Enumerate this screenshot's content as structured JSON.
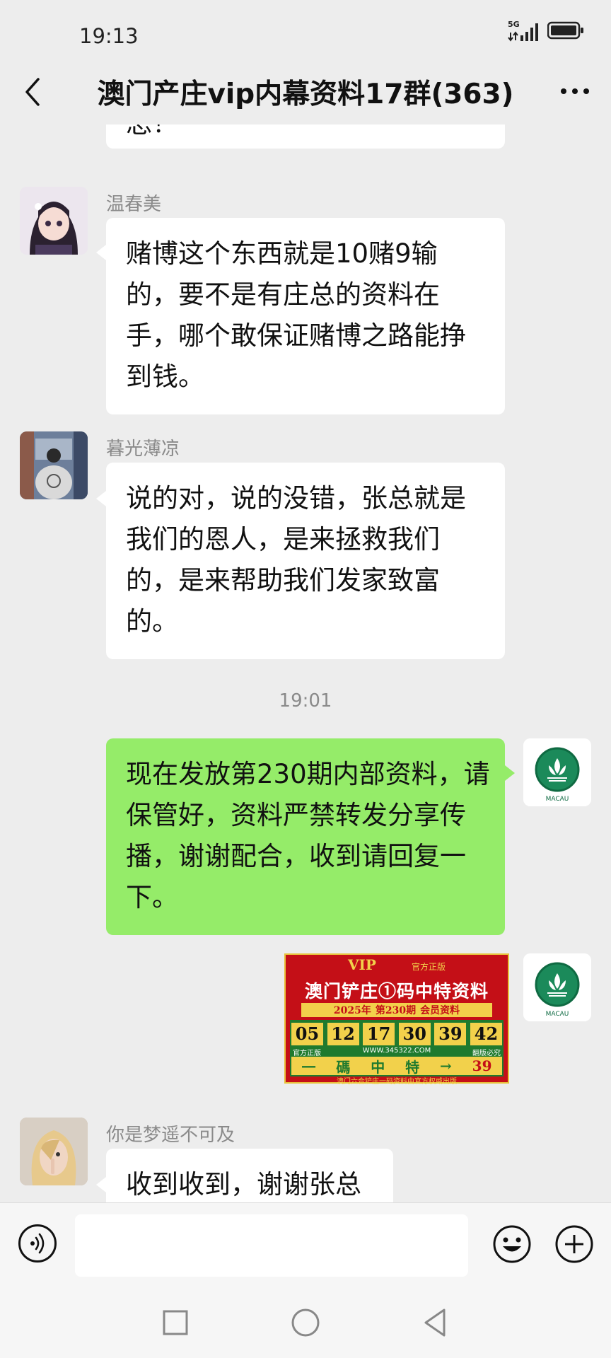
{
  "status": {
    "time": "19:13",
    "network": "5G"
  },
  "header": {
    "title": "澳门产庄vip内幕资料17群(363)"
  },
  "messages": {
    "m0": {
      "text": "总！"
    },
    "m1": {
      "sender": "温春美",
      "text": "赌博这个东西就是10赌9输的，要不是有庄总的资料在手，哪个敢保证赌博之路能挣到钱。"
    },
    "m2": {
      "sender": "暮光薄凉",
      "text": "说的对，说的没错，张总就是我们的恩人，是来拯救我们的，是来帮助我们发家致富的。"
    },
    "timestamp": "19:01",
    "m3": {
      "text": "现在发放第230期内部资料，请保管好，资料严禁转发分享传播，谢谢配合，收到请回复一下。"
    },
    "m5": {
      "sender": "你是梦遥不可及",
      "text": "收到收到，谢谢张总"
    }
  },
  "poster": {
    "vip": "VIP",
    "official": "官方正版",
    "title": "澳门铲庄①码中特资料",
    "year": "2025年",
    "issue": "第230期",
    "member": "会员资料",
    "numbers": [
      "05",
      "12",
      "17",
      "30",
      "39",
      "42"
    ],
    "site_left": "官方正版",
    "site": "WWW.345322.COM",
    "site_right": "翻版必究",
    "one": "一",
    "ma": "碼",
    "zhong": "中",
    "te": "特",
    "arrow": "→",
    "special": "39",
    "footer": "澳门六合铲庄一码资料由官方权威出版"
  },
  "logo_text": "MACAU",
  "colors": {
    "bg": "#ededed",
    "green_bubble": "#95ec69",
    "poster_red": "#c40f17",
    "poster_green": "#1f7a2e",
    "poster_gold": "#f2d14b"
  }
}
